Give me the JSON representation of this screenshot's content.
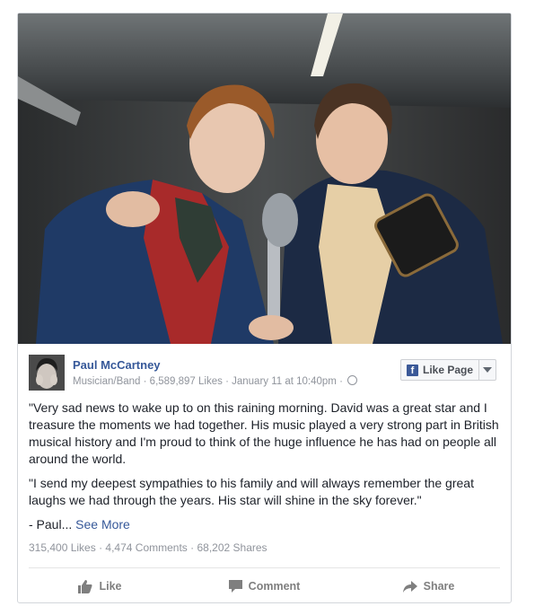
{
  "post": {
    "page_name": "Paul McCartney",
    "category": "Musician/Band",
    "likes_count": "6,589,897 Likes",
    "date": "January 11 at 10:40pm",
    "like_page_label": "Like Page",
    "paragraphs": [
      "\"Very sad news to wake up to on this raining morning. David was a great star and I treasure the moments we had together. His music played a very strong part in British musical history and I'm proud to think of the huge influence he has had on people all around the world.",
      "\"I send my deepest sympathies to his family and will always remember the great laughs we had through the years. His star will shine in the sky forever.\""
    ],
    "signoff": "- Paul...",
    "see_more": "See More",
    "stats": {
      "likes": "315,400 Likes",
      "comments": "4,474 Comments",
      "shares": "68,202 Shares"
    }
  },
  "actions": {
    "like": "Like",
    "comment": "Comment",
    "share": "Share"
  },
  "colors": {
    "link": "#365899",
    "muted": "#90949c",
    "facebook_blue": "#3b5998"
  }
}
